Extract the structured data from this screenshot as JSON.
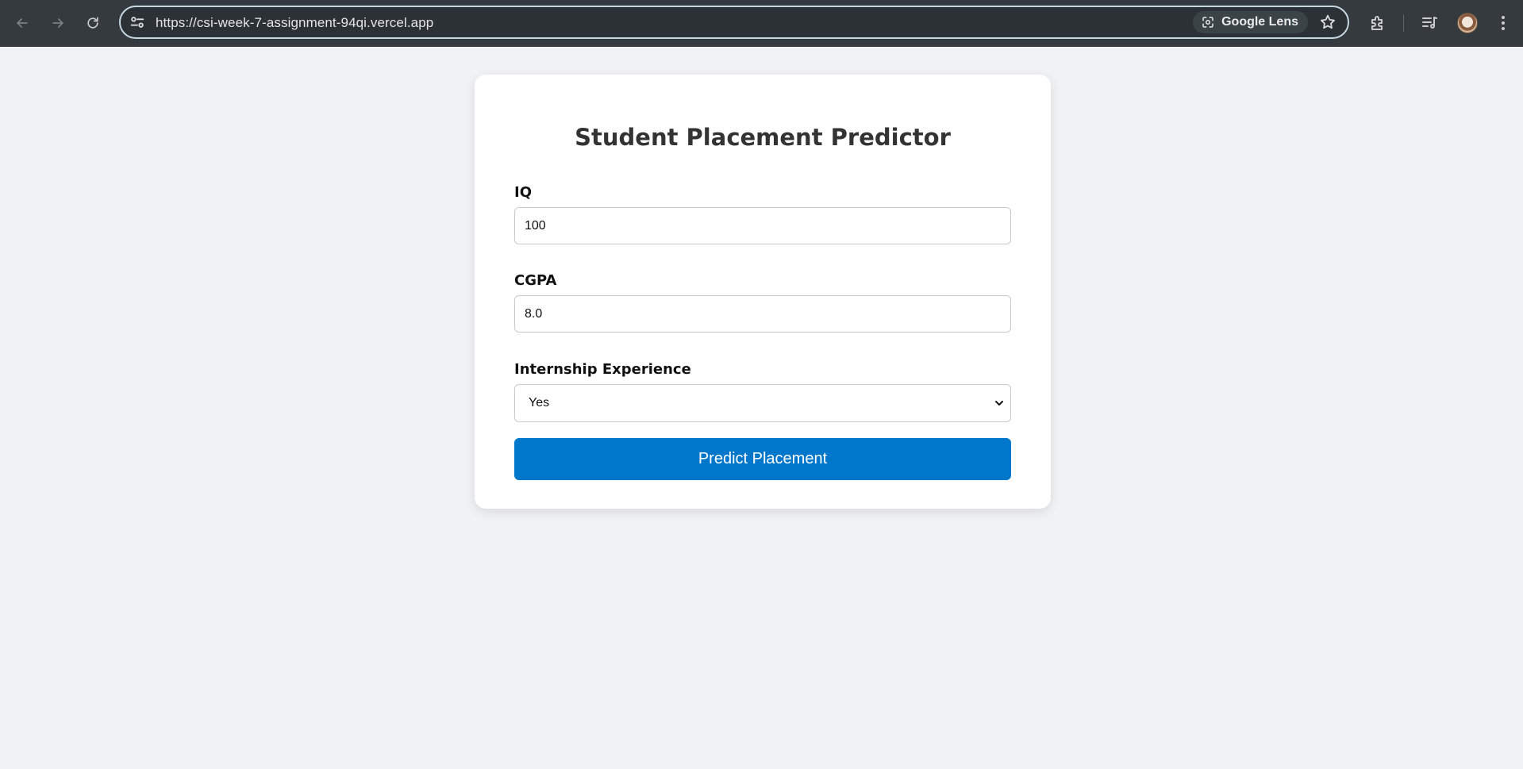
{
  "browser": {
    "url": "https://csi-week-7-assignment-94qi.vercel.app",
    "lens_label": "Google Lens",
    "icons": {
      "back": "arrow-left-icon",
      "forward": "arrow-right-icon",
      "reload": "reload-icon",
      "site_settings": "tune-icon",
      "lens": "google-lens-icon",
      "bookmark": "star-icon",
      "extensions": "puzzle-icon",
      "media": "media-queue-icon",
      "profile": "avatar",
      "menu": "kebab-menu-icon"
    }
  },
  "form": {
    "title": "Student Placement Predictor",
    "iq": {
      "label": "IQ",
      "value": "100"
    },
    "cgpa": {
      "label": "CGPA",
      "value": "8.0"
    },
    "internship": {
      "label": "Internship Experience",
      "selected": "Yes"
    },
    "submit_label": "Predict Placement"
  },
  "colors": {
    "page_background": "#f0f2f5",
    "browser_bar": "#343a3d",
    "primary_button": "#0177cc",
    "card_background": "#ffffff"
  }
}
